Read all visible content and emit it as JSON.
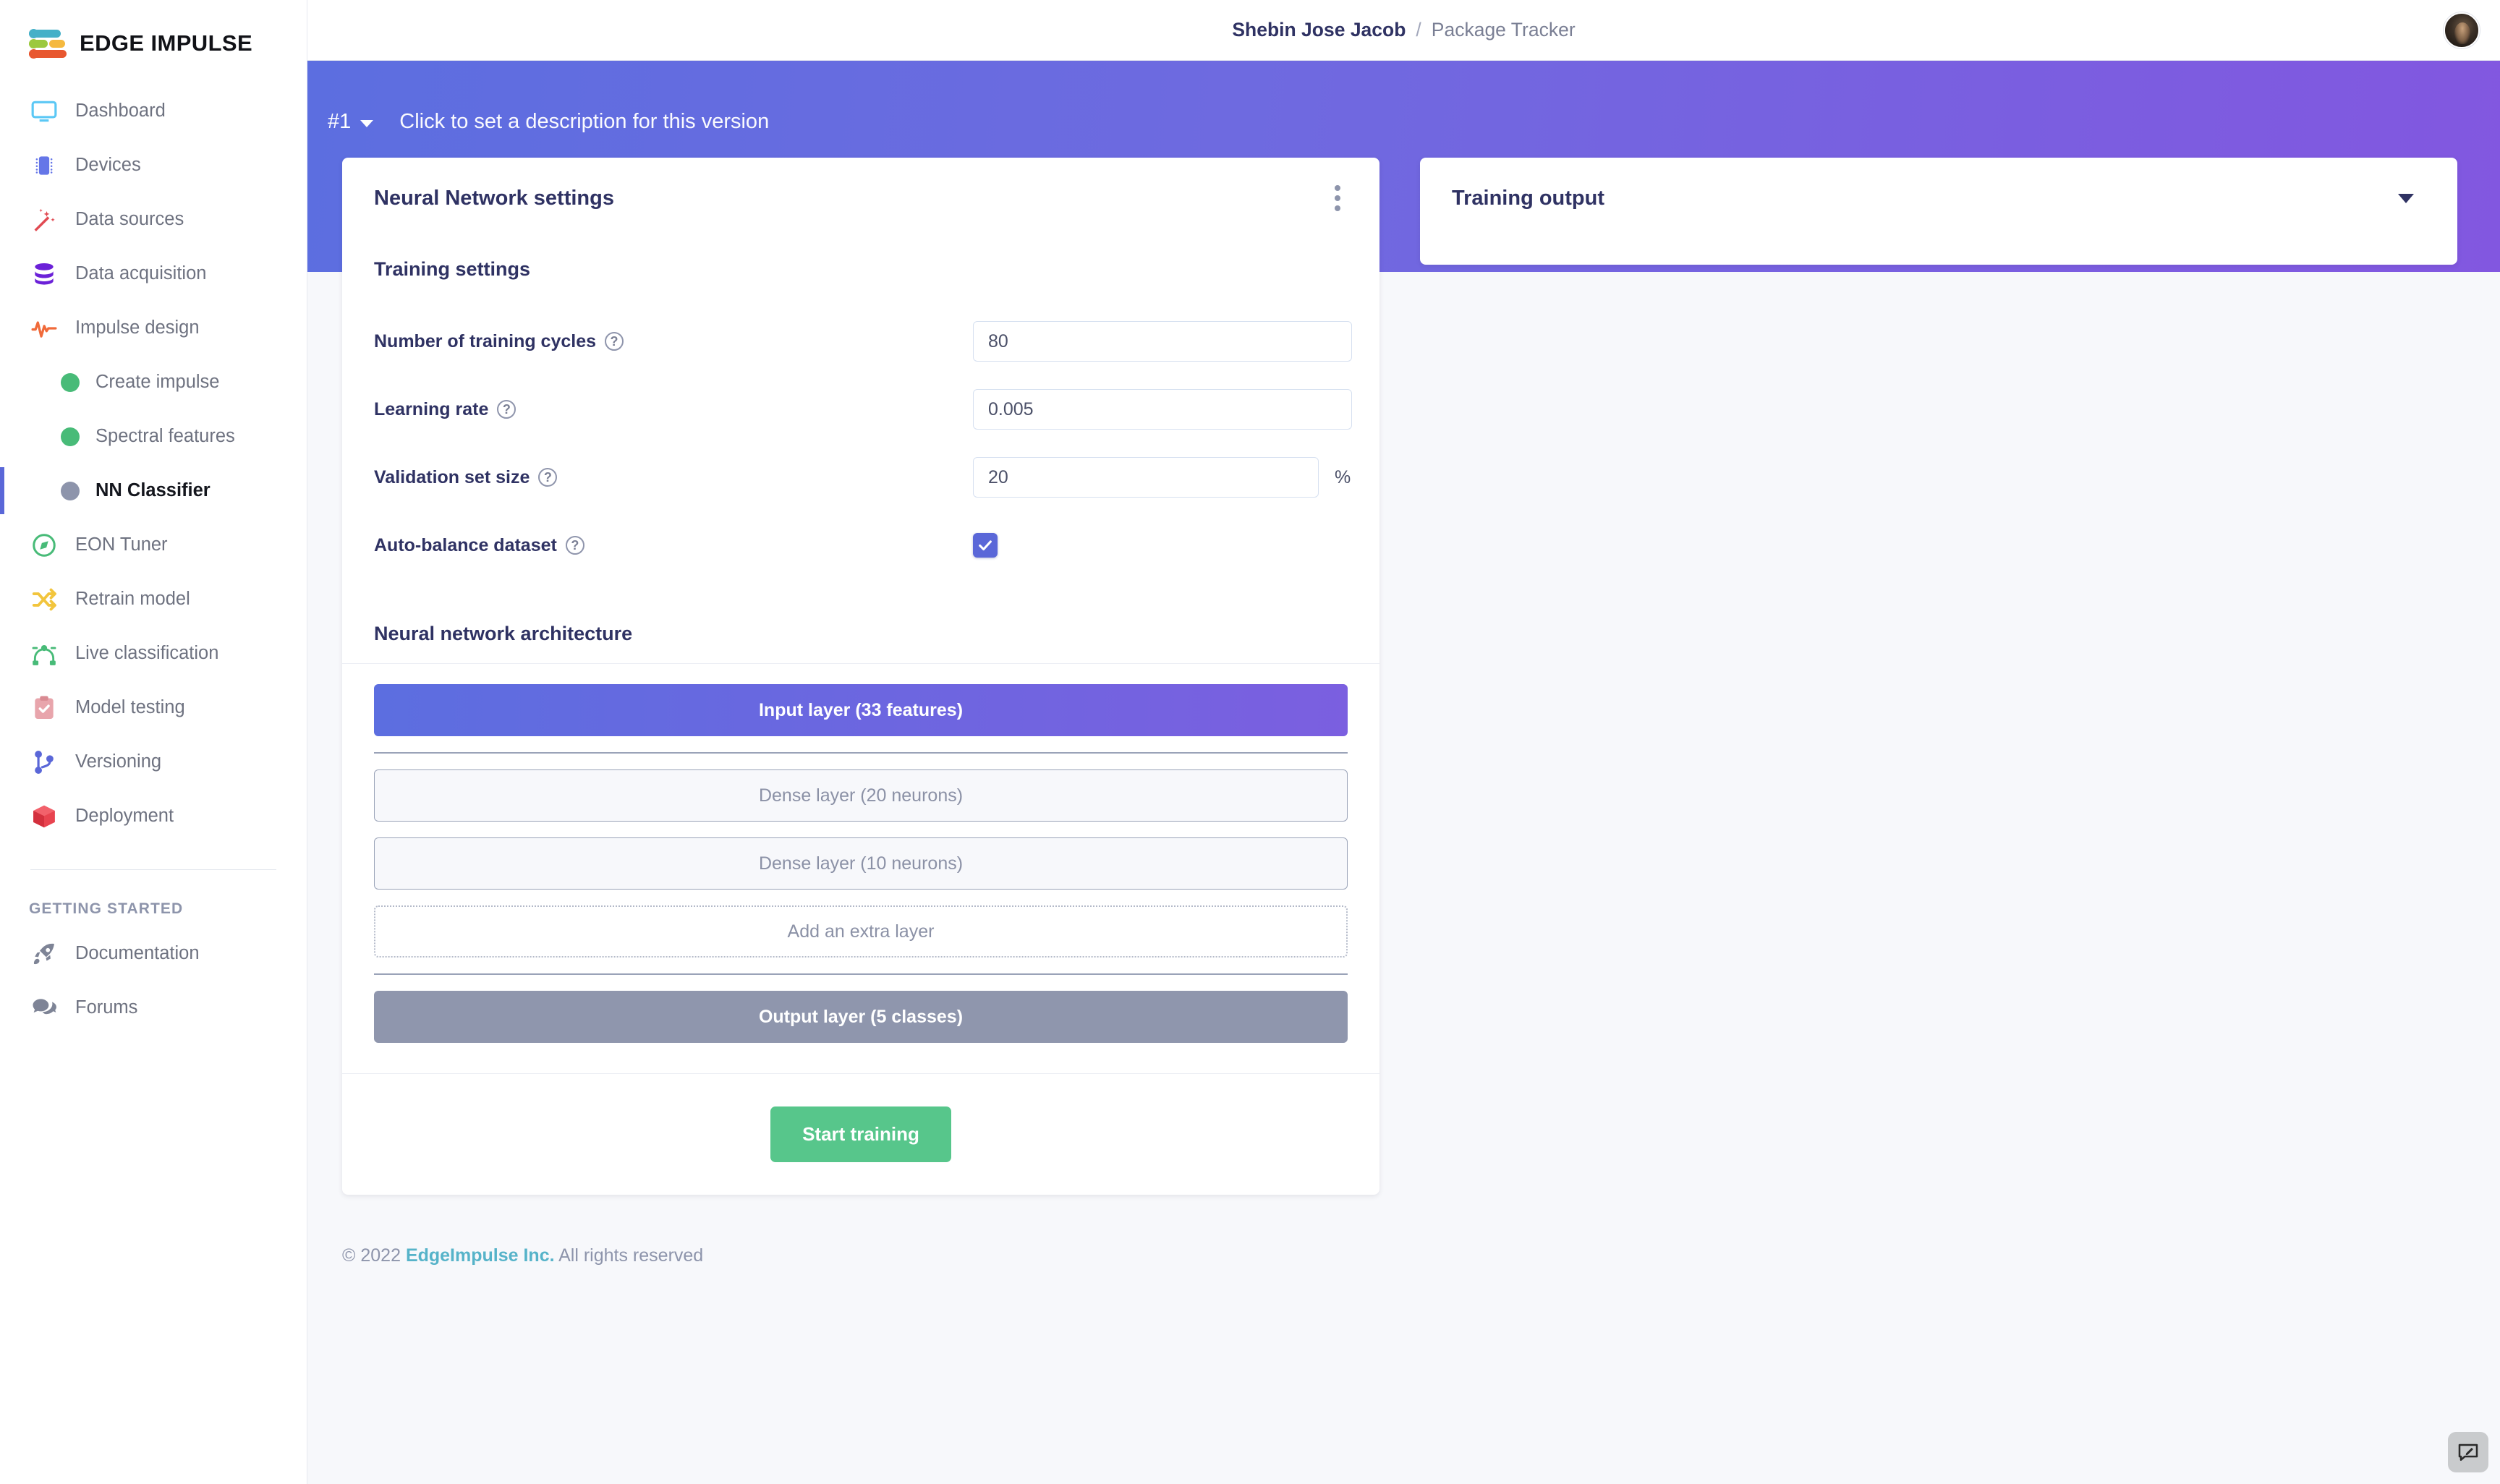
{
  "brand": {
    "name": "EDGE IMPULSE"
  },
  "header": {
    "breadcrumb_owner": "Shebin Jose Jacob",
    "breadcrumb_separator": "/",
    "breadcrumb_project": "Package Tracker"
  },
  "sidebar": {
    "items": [
      {
        "label": "Dashboard",
        "icon": "monitor-icon",
        "active": false
      },
      {
        "label": "Devices",
        "icon": "chip-icon",
        "active": false
      },
      {
        "label": "Data sources",
        "icon": "wand-icon",
        "active": false
      },
      {
        "label": "Data acquisition",
        "icon": "database-icon",
        "active": false
      },
      {
        "label": "Impulse design",
        "icon": "pulse-icon",
        "active": false
      }
    ],
    "sub_items": [
      {
        "label": "Create impulse",
        "status": "green",
        "active": false
      },
      {
        "label": "Spectral features",
        "status": "green",
        "active": false
      },
      {
        "label": "NN Classifier",
        "status": "gray",
        "active": true
      }
    ],
    "items2": [
      {
        "label": "EON Tuner",
        "icon": "compass-icon",
        "active": false
      },
      {
        "label": "Retrain model",
        "icon": "shuffle-icon",
        "active": false
      },
      {
        "label": "Live classification",
        "icon": "nodes-icon",
        "active": false
      },
      {
        "label": "Model testing",
        "icon": "clipboard-icon",
        "active": false
      },
      {
        "label": "Versioning",
        "icon": "branch-icon",
        "active": false
      },
      {
        "label": "Deployment",
        "icon": "box-icon",
        "active": false
      }
    ],
    "section_title": "GETTING STARTED",
    "items3": [
      {
        "label": "Documentation",
        "icon": "rocket-icon",
        "active": false
      },
      {
        "label": "Forums",
        "icon": "chat-icon",
        "active": false
      }
    ]
  },
  "banner": {
    "version": "#1",
    "description": "Click to set a description for this version"
  },
  "nn_card": {
    "title": "Neural Network settings",
    "menu_icon": "kebab-menu-icon",
    "training_settings_heading": "Training settings",
    "fields": [
      {
        "label": "Number of training cycles",
        "value": "80",
        "suffix": "",
        "help": "?"
      },
      {
        "label": "Learning rate",
        "value": "0.005",
        "suffix": "",
        "help": "?"
      },
      {
        "label": "Validation set size",
        "value": "20",
        "suffix": "%",
        "help": "?"
      }
    ],
    "checkbox": {
      "label": "Auto-balance dataset",
      "checked": true,
      "help": "?"
    },
    "architecture_heading": "Neural network architecture",
    "layers": [
      {
        "label": "Input layer (33 features)",
        "type": "input"
      },
      {
        "label": "Dense layer (20 neurons)",
        "type": "dense"
      },
      {
        "label": "Dense layer (10 neurons)",
        "type": "dense"
      },
      {
        "label": "Add an extra layer",
        "type": "add"
      },
      {
        "label": "Output layer (5 classes)",
        "type": "output"
      }
    ],
    "start_button": "Start training"
  },
  "output_card": {
    "title": "Training output",
    "collapse_icon": "chevron-down-icon"
  },
  "footer": {
    "copyright": "© 2022",
    "company": "EdgeImpulse Inc.",
    "rights": "All rights reserved"
  },
  "feedback": {
    "icon": "feedback-pencil-icon"
  },
  "colors": {
    "accent_indigo": "#5a67d8",
    "banner_from": "#5c6ee0",
    "banner_to": "#8257e0",
    "green": "#57c68b",
    "teal": "#56b3c9"
  }
}
